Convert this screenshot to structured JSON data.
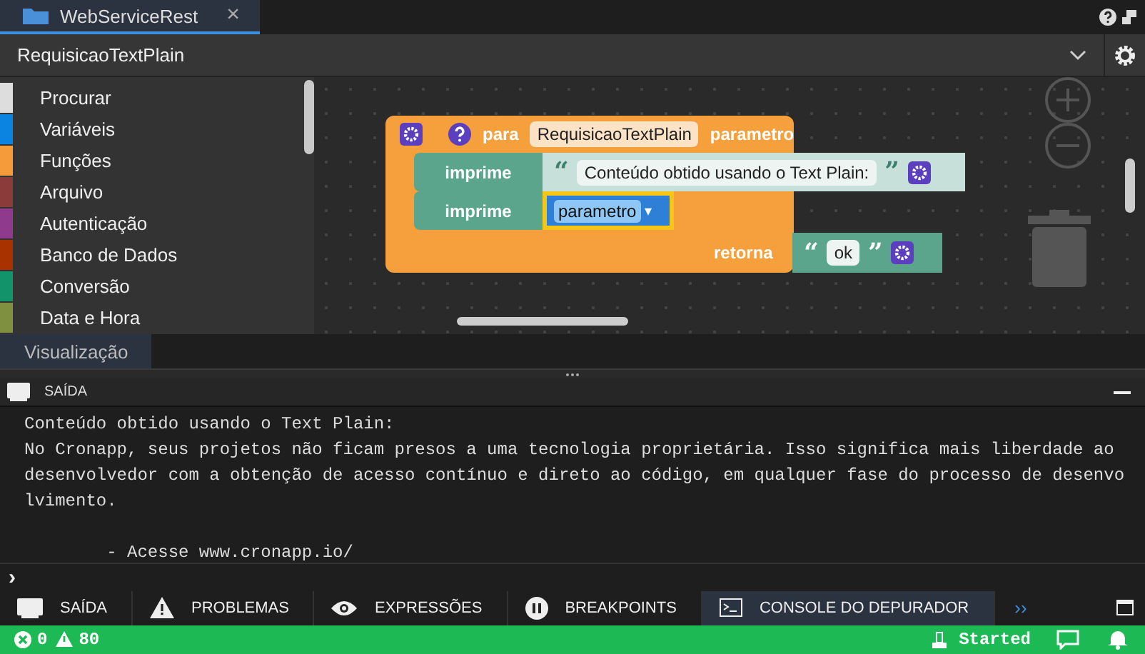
{
  "editor_tabs": [
    {
      "label": "WebServiceRest",
      "selected": true,
      "close": "×"
    }
  ],
  "function_selector": {
    "value": "RequisicaoTextPlain"
  },
  "categories": [
    {
      "label": "Procurar",
      "color": "#dddddd"
    },
    {
      "label": "Variáveis",
      "color": "#0a84e0"
    },
    {
      "label": "Funções",
      "color": "#f59b3a"
    },
    {
      "label": "Arquivo",
      "color": "#8c3b3b"
    },
    {
      "label": "Autenticação",
      "color": "#8f3a8c"
    },
    {
      "label": "Banco de Dados",
      "color": "#a83200"
    },
    {
      "label": "Conversão",
      "color": "#12936a"
    },
    {
      "label": "Data e Hora",
      "color": "#7f9040"
    }
  ],
  "view_tab": {
    "label": "Visualização"
  },
  "blocks": {
    "keyword": "para",
    "function_name": "RequisicaoTextPlain",
    "param": "parametro",
    "statements": [
      {
        "kind": "text",
        "label": "imprime",
        "open_quote": "“",
        "value": "Conteúdo obtido usando o Text Plain:",
        "close_quote": "”"
      },
      {
        "kind": "variable",
        "label": "imprime",
        "value": "parametro",
        "caret": "▾"
      }
    ],
    "return": {
      "label": "retorna",
      "open_quote": "“",
      "value": "ok",
      "close_quote": "”"
    }
  },
  "output": {
    "title": "SAÍDA",
    "paragraphs": [
      [
        "Conteúdo obtido usando o Text Plain:",
        "No Cronapp, seus projetos não ficam presos a uma tecnologia proprietária. Isso significa mais liberdade ao",
        "desenvolvedor com a obtenção de acesso contínuo e direto ao código, em qualquer fase do processo de desenvo",
        "lvimento."
      ],
      [
        "        - Acesse www.cronapp.io/"
      ]
    ],
    "prompt": "›"
  },
  "bottom_tabs": [
    {
      "label": "SAÍDA",
      "kind": "monitor",
      "selected": false
    },
    {
      "label": "PROBLEMAS",
      "kind": "warning",
      "selected": false
    },
    {
      "label": "EXPRESSÕES",
      "kind": "eye",
      "selected": false
    },
    {
      "label": "BREAKPOINTS",
      "kind": "pause",
      "selected": false
    },
    {
      "label": "CONSOLE DO DEPURADOR",
      "kind": "console",
      "selected": true
    }
  ],
  "more_tabs": "››",
  "status_bar": {
    "errors": "0",
    "warnings": "80",
    "server_state": "Started"
  }
}
